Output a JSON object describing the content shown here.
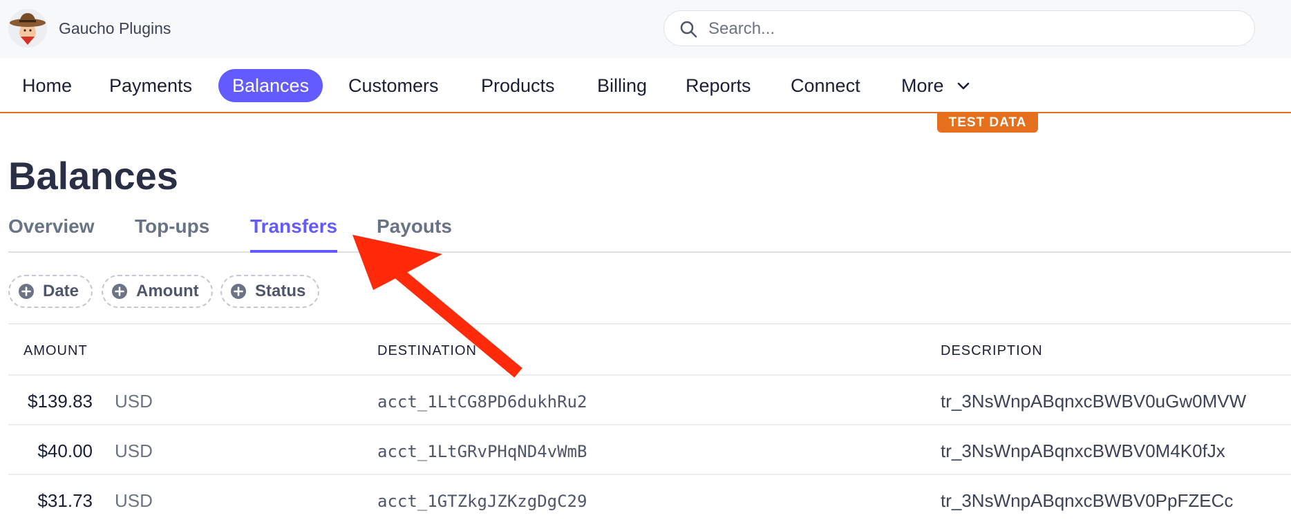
{
  "header": {
    "account_name": "Gaucho Plugins",
    "search_placeholder": "Search..."
  },
  "nav": {
    "items": [
      {
        "label": "Home",
        "active": false
      },
      {
        "label": "Payments",
        "active": false
      },
      {
        "label": "Balances",
        "active": true
      },
      {
        "label": "Customers",
        "active": false
      },
      {
        "label": "Products",
        "active": false
      },
      {
        "label": "Billing",
        "active": false
      },
      {
        "label": "Reports",
        "active": false
      },
      {
        "label": "Connect",
        "active": false
      },
      {
        "label": "More",
        "active": false
      }
    ],
    "test_badge": "TEST DATA"
  },
  "page": {
    "title": "Balances",
    "tabs": [
      {
        "label": "Overview",
        "active": false
      },
      {
        "label": "Top-ups",
        "active": false
      },
      {
        "label": "Transfers",
        "active": true
      },
      {
        "label": "Payouts",
        "active": false
      }
    ],
    "filters": [
      {
        "label": "Date"
      },
      {
        "label": "Amount"
      },
      {
        "label": "Status"
      }
    ]
  },
  "table": {
    "columns": [
      "AMOUNT",
      "DESTINATION",
      "DESCRIPTION"
    ],
    "rows": [
      {
        "amount": "$139.83",
        "currency": "USD",
        "destination": "acct_1LtCG8PD6dukhRu2",
        "description": "tr_3NsWnpABqnxcBWBV0uGw0MVW"
      },
      {
        "amount": "$40.00",
        "currency": "USD",
        "destination": "acct_1LtGRvPHqND4vWmB",
        "description": "tr_3NsWnpABqnxcBWBV0M4K0fJx"
      },
      {
        "amount": "$31.73",
        "currency": "USD",
        "destination": "acct_1GTZkgJZKzgDgC29",
        "description": "tr_3NsWnpABqnxcBWBV0PpFZECc"
      }
    ]
  },
  "colors": {
    "brand": "#635bff",
    "test_mode": "#e56f1b",
    "annotation_arrow": "#ff2a0a"
  },
  "icons": {
    "avatar": "gaucho-avatar-icon",
    "search": "search-icon",
    "more": "chevron-down-icon",
    "filter": "plus-circle-icon",
    "annotation": "arrow-pointer-icon"
  }
}
